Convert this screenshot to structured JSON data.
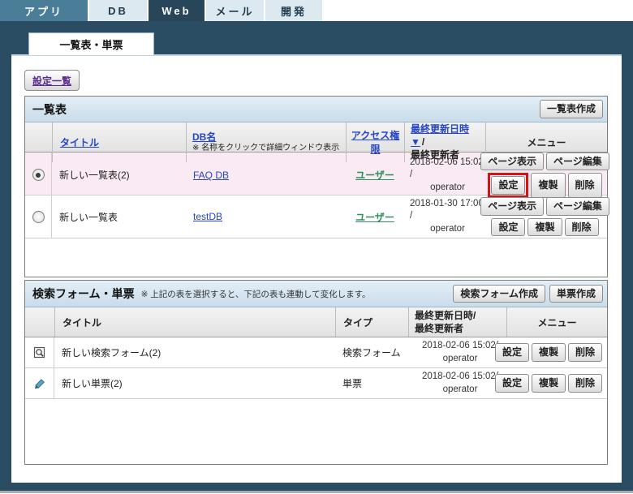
{
  "colors": {
    "frame_navy": "#2b4d63",
    "tab_teal": "#4a7d97",
    "tab_dark": "#27465a",
    "tab_light": "#dde9f0",
    "panel_header_blue": "#cfe0ed",
    "selected_row_pink": "#f9eaf3",
    "link_blue": "#2645c8",
    "link_green": "#2e8f5e",
    "link_purple": "#5b2d8e",
    "highlight_red": "#dd1010"
  },
  "topnav": {
    "tabs": [
      {
        "label": "アプリ"
      },
      {
        "label": "DB"
      },
      {
        "label": "Web",
        "active": true
      },
      {
        "label": "メール"
      },
      {
        "label": "開発"
      }
    ]
  },
  "subtab": {
    "label": "一覧表・単票"
  },
  "settings_list_button": "設定一覧",
  "list_section": {
    "title": "一覧表",
    "create_button": "一覧表作成",
    "columns": {
      "title": "タイトル",
      "db_name": "DB名",
      "db_name_note": "※ 名称をクリックで詳細ウィンドウ表示",
      "access": "アクセス権限",
      "updated_link": "最終更新日時 ▼",
      "updated_suffix": "/",
      "updated_line2": "最終更新者",
      "menu": "メニュー"
    },
    "buttons": {
      "page_view": "ページ表示",
      "page_edit": "ページ編集",
      "settings": "設定",
      "copy": "複製",
      "delete": "削除"
    },
    "rows": [
      {
        "title": "新しい一覧表(2)",
        "db": "FAQ DB",
        "access": "ユーザー",
        "updated": "2018-02-06 15:02 /",
        "updater": "operator",
        "selected": true
      },
      {
        "title": "新しい一覧表",
        "db": "testDB",
        "access": "ユーザー",
        "updated": "2018-01-30 17:00 /",
        "updater": "operator",
        "selected": false
      }
    ]
  },
  "form_section": {
    "title": "検索フォーム・単票",
    "note": "※ 上記の表を選択すると、下記の表も連動して変化します。",
    "create_search_button": "検索フォーム作成",
    "create_single_button": "単票作成",
    "columns": {
      "title": "タイトル",
      "type": "タイプ",
      "updated_line1": "最終更新日時/",
      "updated_line2": "最終更新者",
      "menu": "メニュー"
    },
    "buttons": {
      "settings": "設定",
      "copy": "複製",
      "delete": "削除"
    },
    "rows": [
      {
        "icon": "search-form-icon",
        "title": "新しい検索フォーム(2)",
        "type": "検索フォーム",
        "updated": "2018-02-06 15:02/",
        "updater": "operator"
      },
      {
        "icon": "single-form-icon",
        "title": "新しい単票(2)",
        "type": "単票",
        "updated": "2018-02-06 15:02/",
        "updater": "operator"
      }
    ]
  }
}
